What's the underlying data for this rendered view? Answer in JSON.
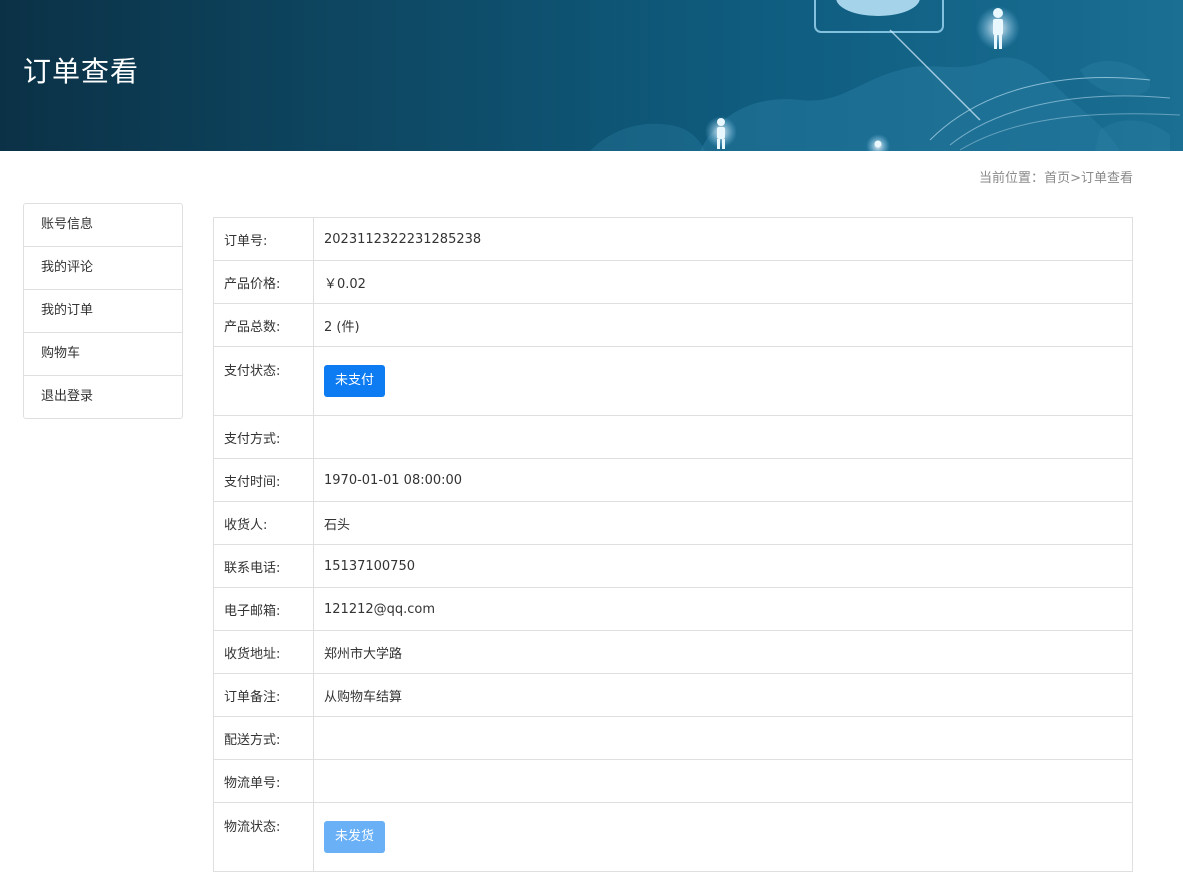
{
  "banner": {
    "title": "订单查看"
  },
  "breadcrumb": {
    "prefix": "当前位置：",
    "home": "首页",
    "separator": ">",
    "current": "订单查看"
  },
  "sidebar": {
    "items": [
      {
        "label": "账号信息"
      },
      {
        "label": "我的评论"
      },
      {
        "label": "我的订单"
      },
      {
        "label": "购物车"
      },
      {
        "label": "退出登录"
      }
    ]
  },
  "order": {
    "rows": [
      {
        "label": "订单号:",
        "value": "2023112322231285238"
      },
      {
        "label": "产品价格:",
        "value": "￥0.02"
      },
      {
        "label": "产品总数:",
        "value": "2 (件)"
      },
      {
        "label": "支付状态:",
        "button": "未支付"
      },
      {
        "label": "支付方式:",
        "value": ""
      },
      {
        "label": "支付时间:",
        "value": "1970-01-01 08:00:00"
      },
      {
        "label": "收货人:",
        "value": "石头"
      },
      {
        "label": "联系电话:",
        "value": "15137100750"
      },
      {
        "label": "电子邮箱:",
        "value": "121212@qq.com"
      },
      {
        "label": "收货地址:",
        "value": "郑州市大学路"
      },
      {
        "label": "订单备注:",
        "value": "从购物车结算"
      },
      {
        "label": "配送方式:",
        "value": ""
      },
      {
        "label": "物流单号:",
        "value": ""
      },
      {
        "label": "物流状态:",
        "button": "未发货"
      }
    ]
  },
  "colors": {
    "primary_button": "#0d7cf2",
    "light_button": "#69b0f7",
    "banner_dark": "#0b3146",
    "border": "#dfdfdf"
  }
}
